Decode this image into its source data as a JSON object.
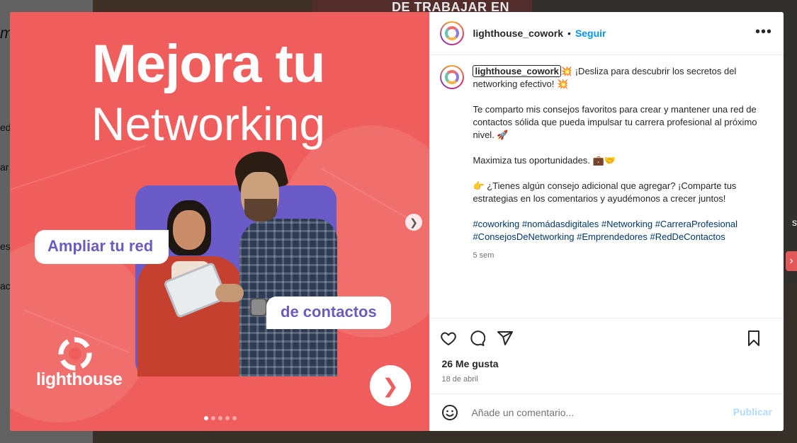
{
  "background": {
    "banner_text": "DE TRABAJAR EN",
    "left_fragments": [
      "m",
      "eda",
      "ar",
      "es",
      "ac"
    ],
    "right_fragment": "s"
  },
  "media": {
    "headline_line1": "Mejora tu",
    "headline_line2": "Networking",
    "pill_1": "Ampliar tu red",
    "pill_2": "de contactos",
    "logo_text": "lighthouse",
    "slide_count": 5,
    "active_slide": 1,
    "colors": {
      "background": "#ef5e5c",
      "card": "#6b5bc9",
      "pill_text": "#6d5bbf"
    }
  },
  "header": {
    "username": "lighthouse_cowork",
    "separator": "•",
    "follow_label": "Seguir",
    "more_label": "•••"
  },
  "caption": {
    "username": "lighthouse_cowork",
    "paragraphs": [
      "💥 ¡Desliza para descubrir los secretos del networking efectivo! 💥",
      "Te comparto mis consejos favoritos para crear y mantener una red de contactos sólida que pueda impulsar tu carrera profesional al próximo nivel. 🚀",
      "Maximiza tus oportunidades. 💼🤝",
      "👉 ¿Tienes algún consejo adicional que agregar? ¡Comparte tus estrategias en los comentarios y ayudémonos a crecer juntos!"
    ],
    "hashtags": "#coworking #nomádasdigitales #Networking #CarreraProfesional #ConsejosDeNetworking #Emprendedores #RedDeContactos",
    "time_ago": "5 sem"
  },
  "footer": {
    "likes": "26 Me gusta",
    "date": "18 de abril",
    "comment_placeholder": "Añade un comentario...",
    "publish_label": "Publicar"
  },
  "icons": {
    "like": "heart-icon",
    "comment": "comment-icon",
    "share": "share-icon",
    "save": "bookmark-icon",
    "emoji": "emoji-icon",
    "more": "more-icon"
  }
}
